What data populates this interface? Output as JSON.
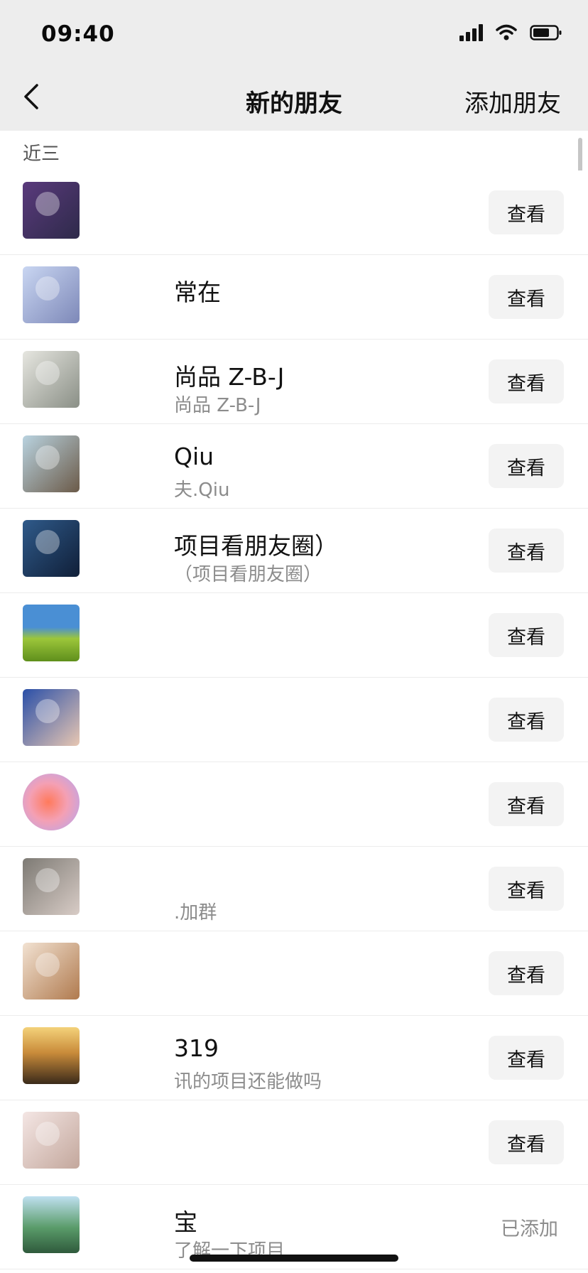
{
  "status_bar": {
    "time": "09:40",
    "icons": [
      "signal-icon",
      "wifi-icon",
      "battery-icon"
    ]
  },
  "nav": {
    "back_icon": "chevron-left-icon",
    "title": "新的朋友",
    "action_label": "添加朋友"
  },
  "section": {
    "label": "近三"
  },
  "colors": {
    "nav_background": "#ededed",
    "button_background": "#f3f3f3",
    "secondary_text": "#8c8c8c"
  },
  "rows": [
    {
      "name": "",
      "message": "",
      "action": "查看",
      "status": ""
    },
    {
      "name": "常在",
      "message": "",
      "action": "查看",
      "status": ""
    },
    {
      "name": "尚品 Z-B-J",
      "message": "尚品 Z-B-J",
      "action": "查看",
      "status": ""
    },
    {
      "name": "Qiu",
      "message": "夫.Qiu",
      "action": "查看",
      "status": ""
    },
    {
      "name": "项目看朋友圈）",
      "message": "（项目看朋友圈）",
      "action": "查看",
      "status": ""
    },
    {
      "name": "",
      "message": "",
      "action": "查看",
      "status": ""
    },
    {
      "name": "",
      "message": "",
      "action": "查看",
      "status": ""
    },
    {
      "name": "",
      "message": "",
      "action": "查看",
      "status": ""
    },
    {
      "name": "",
      "message": ".加群",
      "action": "查看",
      "status": ""
    },
    {
      "name": "",
      "message": "",
      "action": "查看",
      "status": ""
    },
    {
      "name": "319",
      "message": "讯的项目还能做吗",
      "action": "查看",
      "status": ""
    },
    {
      "name": "",
      "message": "",
      "action": "查看",
      "status": ""
    },
    {
      "name": "宝",
      "message": "了解一下项目",
      "action": "",
      "status": "已添加"
    }
  ]
}
